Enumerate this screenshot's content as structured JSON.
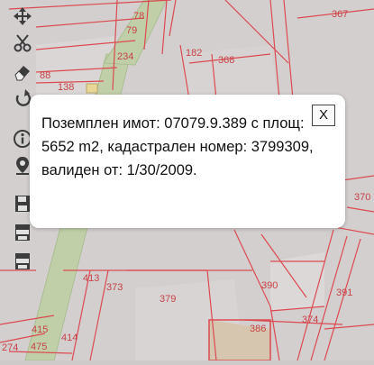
{
  "map": {
    "parcel_numbers": [
      "367",
      "78",
      "79",
      "234",
      "182",
      "368",
      "88",
      "138",
      "370",
      "413",
      "373",
      "379",
      "390",
      "391",
      "386",
      "374",
      "415",
      "414",
      "274",
      "475"
    ]
  },
  "popup": {
    "text": "Поземплен имот: 07079.9.389 с площ: 5652 m2, кадастрален номер: 3799309, валиден от: 1/30/2009.",
    "close_label": "X"
  },
  "toolbar": {
    "tools": [
      "pan-icon",
      "cut-icon",
      "eraser-icon",
      "undo-icon",
      "info-icon",
      "locate-icon",
      "save-icon",
      "export-dxf-icon",
      "export-json-icon"
    ]
  },
  "colors": {
    "parcel_line": "#d8313a",
    "road": "#b6c79b",
    "background": "#cfcaca",
    "popup_bg": "#ffffff"
  }
}
